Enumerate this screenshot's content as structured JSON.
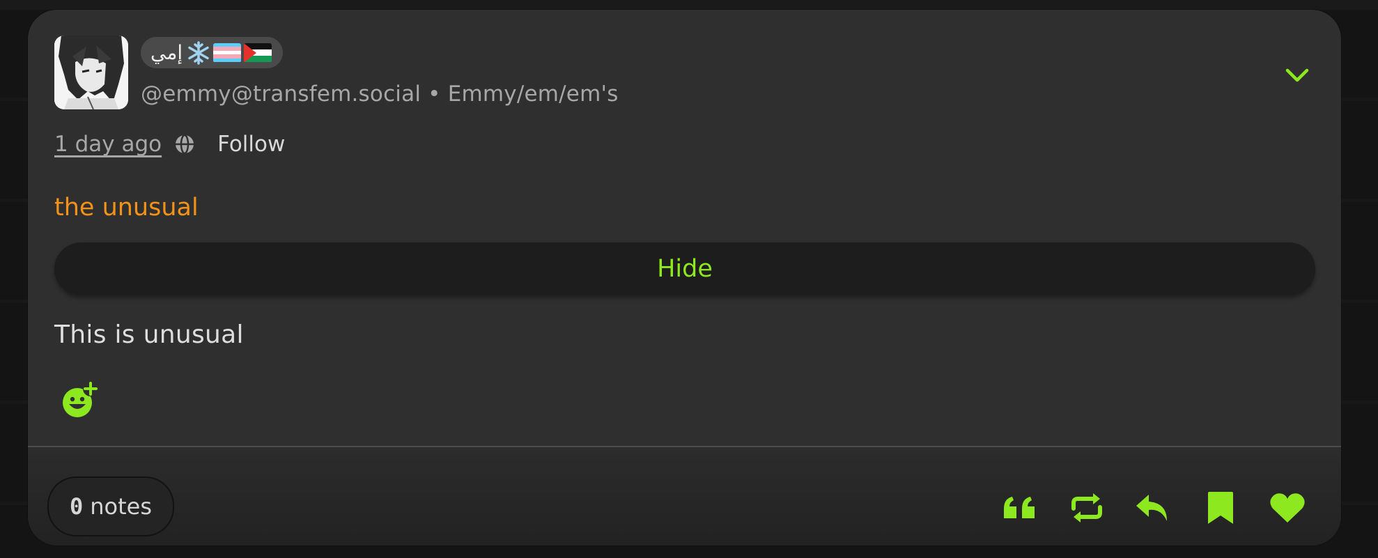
{
  "post": {
    "author": {
      "display_name": "إمي",
      "emoji": [
        "snowflake-emoji",
        "trans-flag-emoji",
        "palestine-flag-emoji"
      ],
      "handle_line": "@emmy@transfem.social • Emmy/em/em's"
    },
    "meta": {
      "time": "1 day ago",
      "visibility_icon": "globe-icon",
      "follow_label": "Follow"
    },
    "content_warning": "the unusual",
    "hide_label": "Hide",
    "body": "This is unusual",
    "notes": {
      "count": "0",
      "label": "notes"
    },
    "actions": [
      "quote-icon",
      "boost-icon",
      "reply-icon",
      "bookmark-icon",
      "like-icon"
    ]
  },
  "colors": {
    "accent": "#8ee820",
    "cw": "#f2921a",
    "card": "#2f2f2f"
  }
}
